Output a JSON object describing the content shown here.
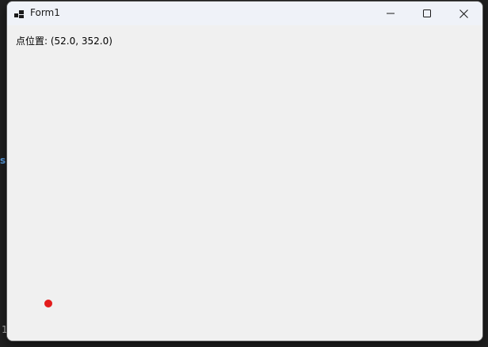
{
  "window": {
    "title": "Form1",
    "icon": "app-window-icon",
    "controls": {
      "minimize_icon": "minimize-icon",
      "maximize_icon": "maximize-icon",
      "close_icon": "close-icon"
    }
  },
  "content": {
    "position_label": "点位置: (52.0, 352.0)",
    "point_color": "#e31c1c"
  },
  "colors": {
    "titlebar": "#eff2f8",
    "client": "#f0f0f0",
    "desktop": "#202020"
  }
}
